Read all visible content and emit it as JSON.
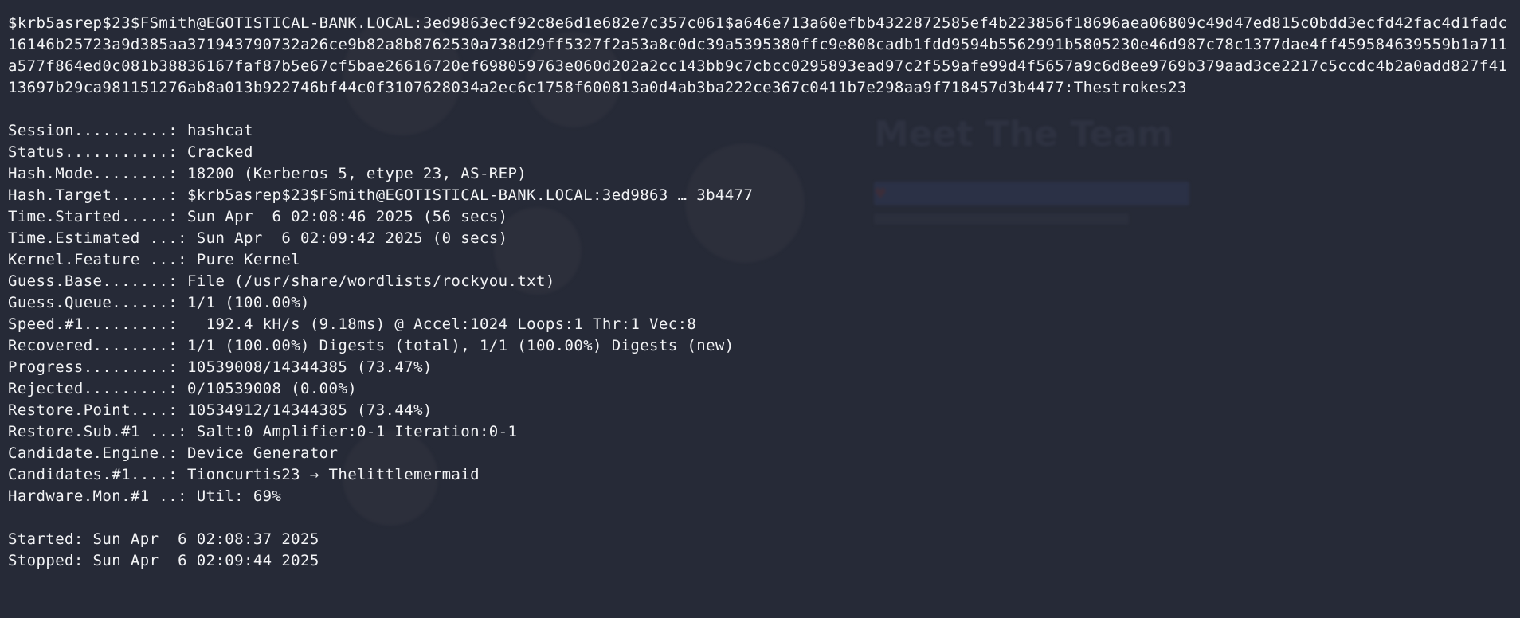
{
  "terminal": {
    "cracked_hash": "$krb5asrep$23$FSmith@EGOTISTICAL-BANK.LOCAL:3ed9863ecf92c8e6d1e682e7c357c061$a646e713a60efbb4322872585ef4b223856f18696aea06809c49d47ed815c0bdd3ecfd42fac4d1fadc16146b25723a9d385aa371943790732a26ce9b82a8b8762530a738d29ff5327f2a53a8c0dc39a5395380ffc9e808cadb1fdd9594b5562991b5805230e46d987c78c1377dae4ff459584639559b1a711a577f864ed0c081b38836167faf87b5e67cf5bae26616720ef698059763e060d202a2cc143bb9c7cbcc0295893ead97c2f559afe99d4f5657a9c6d8ee9769b379aad3ce2217c5ccdc4b2a0add827f4113697b29ca981151276ab8a013b922746bf44c0f3107628034a2ec6c1758f600813a0d4ab3ba222ce367c0411b7e298aa9f718457d3b4477:Thestrokes23",
    "status_lines": [
      "Session..........: hashcat",
      "Status...........: Cracked",
      "Hash.Mode........: 18200 (Kerberos 5, etype 23, AS-REP)",
      "Hash.Target......: $krb5asrep$23$FSmith@EGOTISTICAL-BANK.LOCAL:3ed9863 … 3b4477",
      "Time.Started.....: Sun Apr  6 02:08:46 2025 (56 secs)",
      "Time.Estimated ...: Sun Apr  6 02:09:42 2025 (0 secs)",
      "Kernel.Feature ...: Pure Kernel",
      "Guess.Base.......: File (/usr/share/wordlists/rockyou.txt)",
      "Guess.Queue......: 1/1 (100.00%)",
      "Speed.#1.........:   192.4 kH/s (9.18ms) @ Accel:1024 Loops:1 Thr:1 Vec:8",
      "Recovered........: 1/1 (100.00%) Digests (total), 1/1 (100.00%) Digests (new)",
      "Progress.........: 10539008/14344385 (73.47%)",
      "Rejected.........: 0/10539008 (0.00%)",
      "Restore.Point....: 10534912/14344385 (73.44%)",
      "Restore.Sub.#1 ...: Salt:0 Amplifier:0-1 Iteration:0-1",
      "Candidate.Engine.: Device Generator",
      "Candidates.#1....: Tioncurtis23 → Thelittlemermaid",
      "Hardware.Mon.#1 ..: Util: 69%"
    ],
    "started": "Started: Sun Apr  6 02:08:37 2025",
    "stopped": "Stopped: Sun Apr  6 02:09:44 2025"
  },
  "background_window": {
    "heading": "Meet The Team"
  },
  "colors": {
    "terminal_background": "#262a37",
    "terminal_text": "#f3f4f6"
  }
}
